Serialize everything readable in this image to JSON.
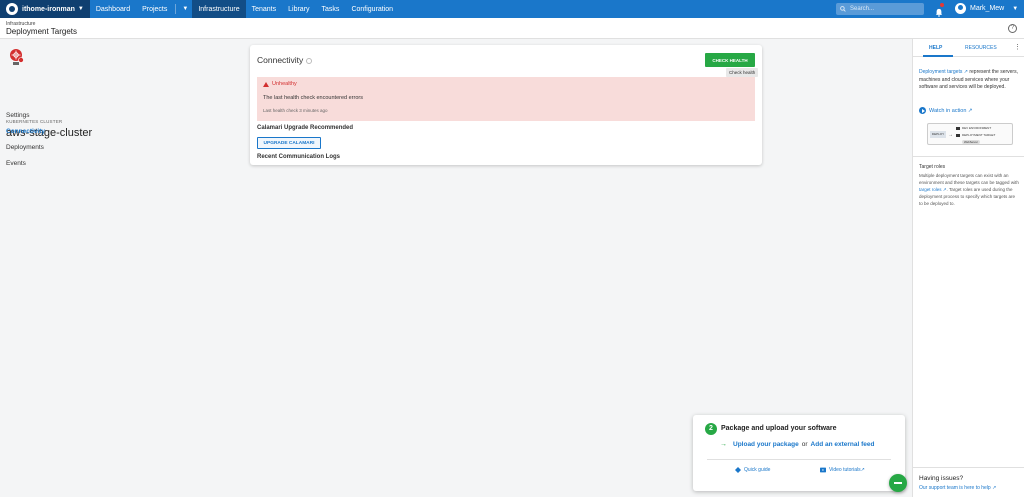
{
  "topnav": {
    "space_name": "ithome-ironman",
    "items": [
      {
        "label": "Dashboard"
      },
      {
        "label": "Projects"
      },
      {
        "label": "Infrastructure"
      },
      {
        "label": "Tenants"
      },
      {
        "label": "Library"
      },
      {
        "label": "Tasks"
      },
      {
        "label": "Configuration"
      }
    ],
    "search_placeholder": "Search...",
    "user_name": "Mark_Mew"
  },
  "header": {
    "breadcrumb": "Infrastructure",
    "title": "Deployment Targets"
  },
  "target": {
    "kind": "KUBERNETES CLUSTER",
    "name": "aws-stage-cluster"
  },
  "sidebar": {
    "items": [
      {
        "label": "Settings"
      },
      {
        "label": "Connectivity"
      },
      {
        "label": "Deployments"
      },
      {
        "label": "Events"
      }
    ]
  },
  "card": {
    "title": "Connectivity",
    "check_health": "CHECK HEALTH",
    "tooltip": "Check health",
    "alert_title": "Unhealthy",
    "alert_message": "The last health check encountered errors",
    "alert_sub": "Last health check 3 minutes ago",
    "upgrade_heading": "Calamari Upgrade Recommended",
    "upgrade_button": "UPGRADE CALAMARI",
    "logs_heading": "Recent Communication Logs"
  },
  "help": {
    "tab_help": "HELP",
    "tab_resources": "RESOURCES",
    "intro_link": "Deployment targets",
    "intro_text": "represent the servers, machines and cloud services where your software and services will be deployed.",
    "watch": "Watch in action",
    "diagram": {
      "deploy": "DEPLOY",
      "env": "DEV ENVIRONMENT",
      "target": "DEPLOYMENT TARGET",
      "tag": "WebServer"
    },
    "roles_title": "Target roles",
    "roles_p1": "Multiple deployment targets can exist with an environment and these targets can be tagged with",
    "roles_link": "target roles",
    "roles_p2": ". Target roles are used during the deployment process to specify which targets are to be deployed to.",
    "issues": "Having issues?",
    "support": "Our support team is here to help"
  },
  "onboarding": {
    "step": "2",
    "title": "Package and upload your software",
    "link1": "Upload your package",
    "or": "or",
    "link2": "Add an external feed",
    "quick": "Quick guide",
    "video": "Video tutorials"
  },
  "colors": {
    "nav": "#1a77ca",
    "space": "#0f3f70",
    "success": "#27a845",
    "danger": "#d32f2f",
    "alert_bg": "#f8dcda"
  }
}
